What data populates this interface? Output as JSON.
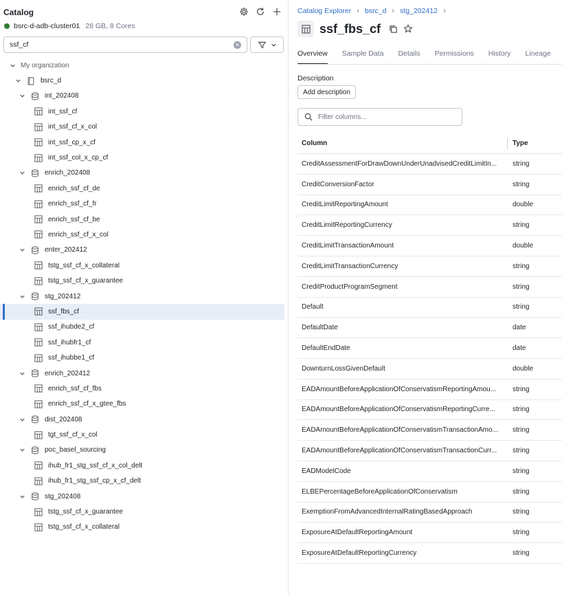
{
  "catalog": {
    "title": "Catalog",
    "cluster": {
      "name": "bsrc-d-adb-cluster01",
      "meta": "28 GB, 8 Cores",
      "status_color": "#2e7d32"
    },
    "search": {
      "value": "ssf_cf"
    }
  },
  "tree": {
    "org": "My organization",
    "catalog": "bsrc_d",
    "schemas": [
      {
        "name": "int_202408",
        "tables": [
          "int_ssf_cf",
          "int_ssf_cf_x_col",
          "int_ssf_cp_x_cf",
          "int_ssf_col_x_cp_cf"
        ]
      },
      {
        "name": "enrich_202408",
        "tables": [
          "enrich_ssf_cf_de",
          "enrich_ssf_cf_fr",
          "enrich_ssf_cf_be",
          "enrich_ssf_cf_x_col"
        ]
      },
      {
        "name": "enter_202412",
        "tables": [
          "tstg_ssf_cf_x_collateral",
          "tstg_ssf_cf_x_guarantee"
        ]
      },
      {
        "name": "stg_202412",
        "tables": [
          "ssf_fbs_cf",
          "ssf_ihubde2_cf",
          "ssf_ihubfr1_cf",
          "ssf_ihubbe1_cf"
        ]
      },
      {
        "name": "enrich_202412",
        "tables": [
          "enrich_ssf_cf_fbs",
          "enrich_ssf_cf_x_gtee_fbs"
        ]
      },
      {
        "name": "dist_202408",
        "tables": [
          "tgt_ssf_cf_x_col"
        ]
      },
      {
        "name": "poc_basel_sourcing",
        "tables": [
          "ihub_fr1_stg_ssf_cf_x_col_delt",
          "ihub_fr1_stg_ssf_cp_x_cf_delt"
        ]
      },
      {
        "name": "stg_202408",
        "tables": [
          "tstg_ssf_cf_x_guarantee",
          "tstg_ssf_cf_x_collateral"
        ]
      }
    ],
    "selected": "ssf_fbs_cf"
  },
  "breadcrumb": [
    "Catalog Explorer",
    "bsrc_d",
    "stg_202412"
  ],
  "table": {
    "name": "ssf_fbs_cf"
  },
  "tabs": [
    "Overview",
    "Sample Data",
    "Details",
    "Permissions",
    "History",
    "Lineage"
  ],
  "active_tab": "Overview",
  "description": {
    "label": "Description",
    "button": "Add description"
  },
  "filter_columns": {
    "placeholder": "Filter columns..."
  },
  "columns": {
    "headers": [
      "Column",
      "Type"
    ],
    "rows": [
      [
        "CreditAssessmentForDrawDownUnderUnadvisedCreditLimitIn...",
        "string"
      ],
      [
        "CreditConversionFactor",
        "string"
      ],
      [
        "CreditLimitReportingAmount",
        "double"
      ],
      [
        "CreditLimitReportingCurrency",
        "string"
      ],
      [
        "CreditLimitTransactionAmount",
        "double"
      ],
      [
        "CreditLimitTransactionCurrency",
        "string"
      ],
      [
        "CreditProductProgramSegment",
        "string"
      ],
      [
        "Default",
        "string"
      ],
      [
        "DefaultDate",
        "date"
      ],
      [
        "DefaultEndDate",
        "date"
      ],
      [
        "DownturnLossGivenDefault",
        "double"
      ],
      [
        "EADAmountBeforeApplicationOfConservatismReportingAmou...",
        "string"
      ],
      [
        "EADAmountBeforeApplicationOfConservatismReportingCurre...",
        "string"
      ],
      [
        "EADAmountBeforeApplicationOfConservatismTransactionAmo...",
        "string"
      ],
      [
        "EADAmountBeforeApplicationOfConservatismTransactionCurr...",
        "string"
      ],
      [
        "EADModelCode",
        "string"
      ],
      [
        "ELBEPercentageBeforeApplicationOfConservatism",
        "string"
      ],
      [
        "ExemptionFromAdvancedInternalRatingBasedApproach",
        "string"
      ],
      [
        "ExposureAtDefaultReportingAmount",
        "string"
      ],
      [
        "ExposureAtDefaultReportingCurrency",
        "string"
      ]
    ]
  },
  "icons": {
    "settings": "gear-icon",
    "refresh": "refresh-icon",
    "add": "plus-icon",
    "filter": "funnel-icon",
    "table": "table-icon",
    "copy": "copy-icon",
    "star": "star-icon"
  }
}
